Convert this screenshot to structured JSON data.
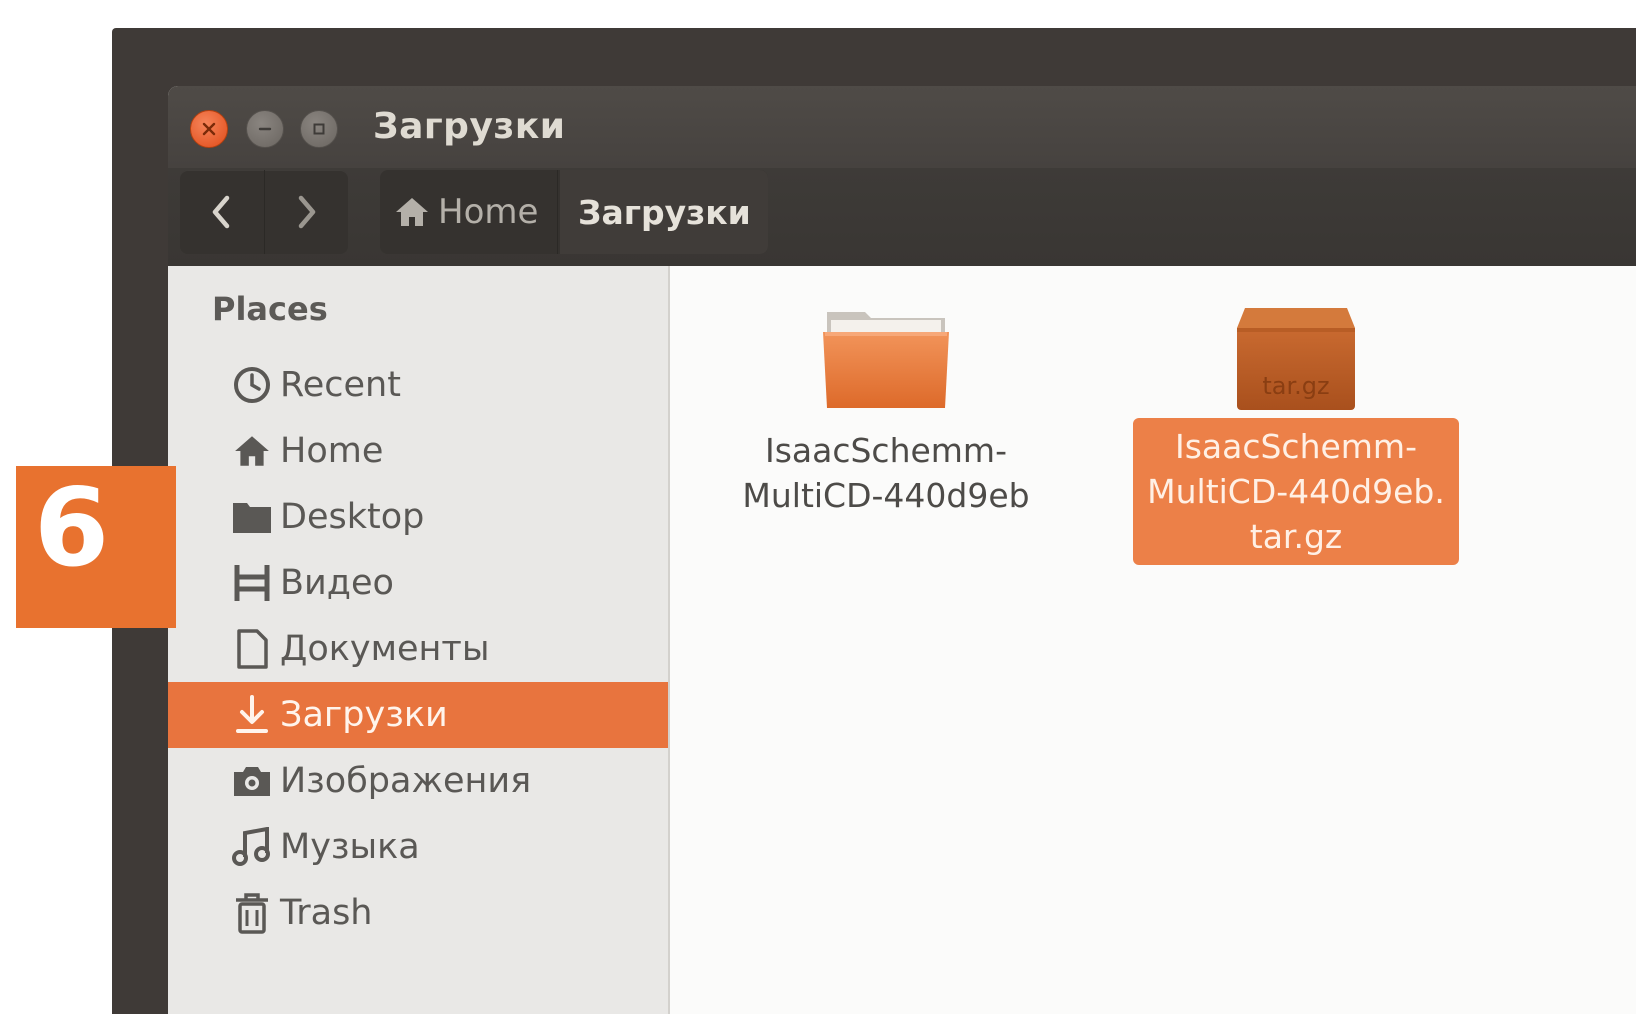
{
  "window": {
    "title": "Загрузки",
    "controls": [
      "close",
      "minimize",
      "maximize"
    ]
  },
  "toolbar": {
    "back_icon": "chevron-left-icon",
    "forward_icon": "chevron-right-icon",
    "breadcrumb": {
      "home_icon": "home-icon",
      "home_label": "Home",
      "current_label": "Загрузки"
    }
  },
  "sidebar": {
    "header": "Places",
    "items": [
      {
        "label": "Recent",
        "icon": "clock-icon",
        "active": false
      },
      {
        "label": "Home",
        "icon": "home-icon",
        "active": false
      },
      {
        "label": "Desktop",
        "icon": "folder-icon",
        "active": false
      },
      {
        "label": "Видео",
        "icon": "film-icon",
        "active": false
      },
      {
        "label": "Документы",
        "icon": "document-icon",
        "active": false
      },
      {
        "label": "Загрузки",
        "icon": "download-icon",
        "active": true
      },
      {
        "label": "Изображения",
        "icon": "camera-icon",
        "active": false
      },
      {
        "label": "Музыка",
        "icon": "music-icon",
        "active": false
      },
      {
        "label": "Trash",
        "icon": "trash-icon",
        "active": false
      }
    ]
  },
  "files": [
    {
      "name": "IsaacSchemm-\nMultiCD-440d9eb",
      "type": "folder",
      "icon": "folder-icon",
      "selected": false
    },
    {
      "name": "IsaacSchemm-\nMultiCD-440d9eb.\ntar.gz",
      "type": "archive",
      "icon": "archive-icon",
      "icon_label": "tar.gz",
      "selected": true
    }
  ],
  "step_badge": {
    "number": "6"
  },
  "colors": {
    "accent": "#e8743e",
    "titlebar": "#4a4643",
    "sidebar_bg": "#e9e8e6",
    "content_bg": "#fbfbfa"
  }
}
